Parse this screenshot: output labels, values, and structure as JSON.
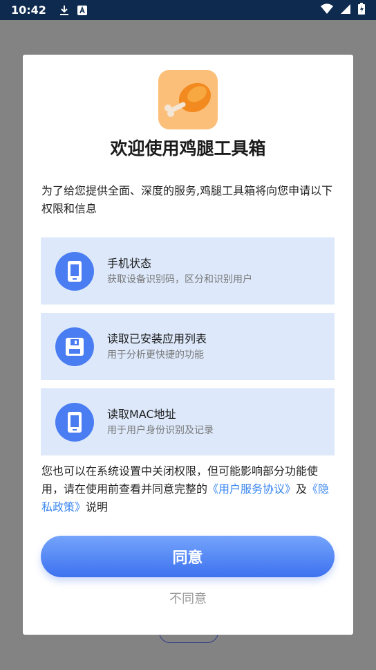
{
  "status_bar": {
    "time": "10:42",
    "icons": [
      "download-icon",
      "a-notification-icon",
      "wifi-icon",
      "signal-icon",
      "battery-icon"
    ]
  },
  "dialog": {
    "title": "欢迎使用鸡腿工具箱",
    "intro": "为了给您提供全面、深度的服务,鸡腿工具箱将向您申请以下权限和信息",
    "permissions": [
      {
        "title": "手机状态",
        "desc": "获取设备识别码，区分和识别用户",
        "icon": "phone-icon"
      },
      {
        "title": "读取已安装应用列表",
        "desc": "用于分析更快捷的功能",
        "icon": "floppy-icon"
      },
      {
        "title": "读取MAC地址",
        "desc": "用于用户身份识别及记录",
        "icon": "phone-icon"
      }
    ],
    "notice": {
      "text_a": "您也可以在系统设置中关闭权限，但可能影响部分功能使用，请在使用前查看并同意完整的",
      "link_terms": "《用户服务协议》",
      "text_b": "及",
      "link_privacy": "《隐私政策》",
      "text_c": "说明"
    },
    "agree_label": "同意",
    "disagree_label": "不同意"
  },
  "colors": {
    "status_bar": "#0e2a4f",
    "accent": "#4a7df2",
    "link": "#3b87f0",
    "permission_bg": "#dde9fb",
    "app_icon_bg": "#fbbf7a"
  }
}
